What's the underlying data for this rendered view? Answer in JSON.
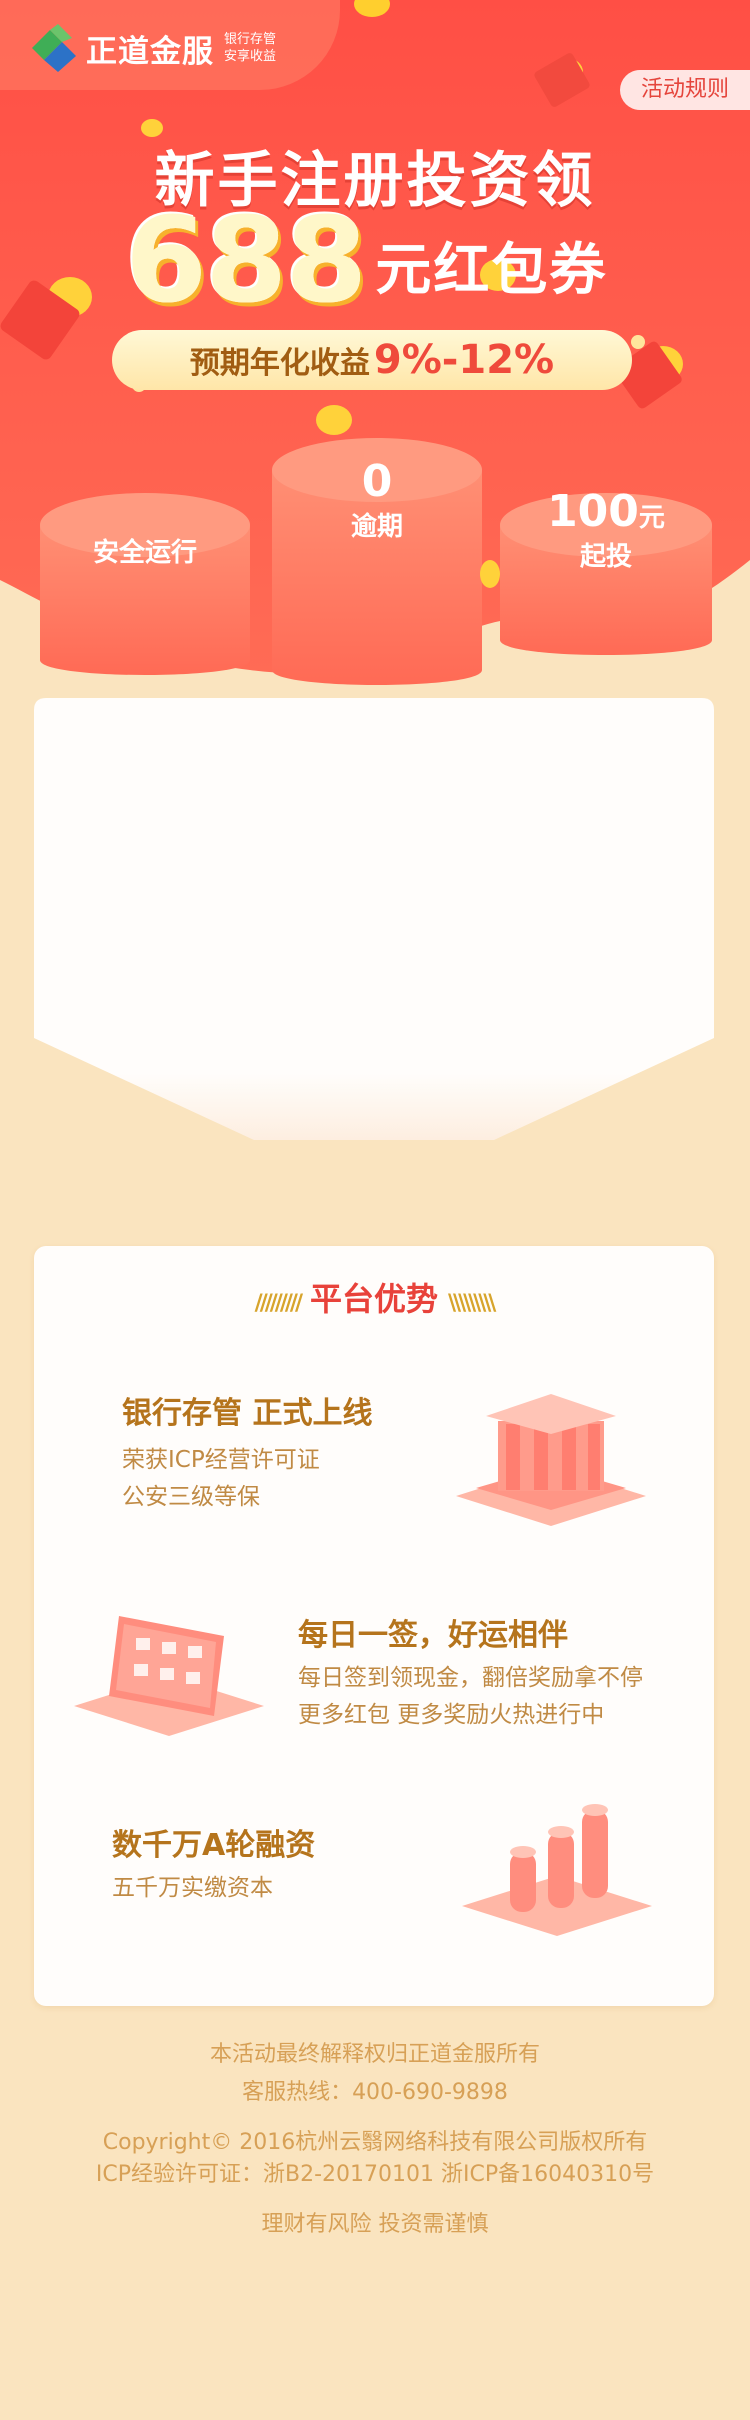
{
  "brand": {
    "name": "正道金服",
    "slogan_line1": "银行存管",
    "slogan_line2": "安享收益"
  },
  "rules_button": "活动规则",
  "hero": {
    "line1": "新手注册投资领",
    "amount": "688",
    "line2_rest": "元红包券",
    "yield_label": "预期年化收益",
    "yield_range": "9%-12%"
  },
  "drums": [
    {
      "main": "",
      "sub": "安全运行"
    },
    {
      "main": "0",
      "sub": "逾期"
    },
    {
      "main": "100",
      "unit": "元",
      "sub": "起投"
    }
  ],
  "advantages": {
    "title": "平台优势",
    "items": [
      {
        "title": "银行存管  正式上线",
        "lines": [
          "荣获ICP经营许可证",
          "公安三级等保"
        ]
      },
      {
        "title": "每日一签，好运相伴",
        "lines": [
          "每日签到领现金，翻倍奖励拿不停",
          "更多红包 更多奖励火热进行中"
        ]
      },
      {
        "title": "数千万A轮融资",
        "lines": [
          "五千万实缴资本"
        ]
      }
    ]
  },
  "footer": {
    "ownership": "本活动最终解释权归正道金服所有",
    "hotline": "客服热线：400-690-9898",
    "copyright": "Copyright© 2016杭州云翳网络科技有限公司版权所有",
    "license": "ICP经验许可证：浙B2-20170101 浙ICP备16040310号",
    "risk": "理财有风险 投资需谨慎"
  },
  "colors": {
    "page_bg": "#fae4bf",
    "hero_red": "#fd5a4c",
    "accent_gold": "#b5741c"
  }
}
